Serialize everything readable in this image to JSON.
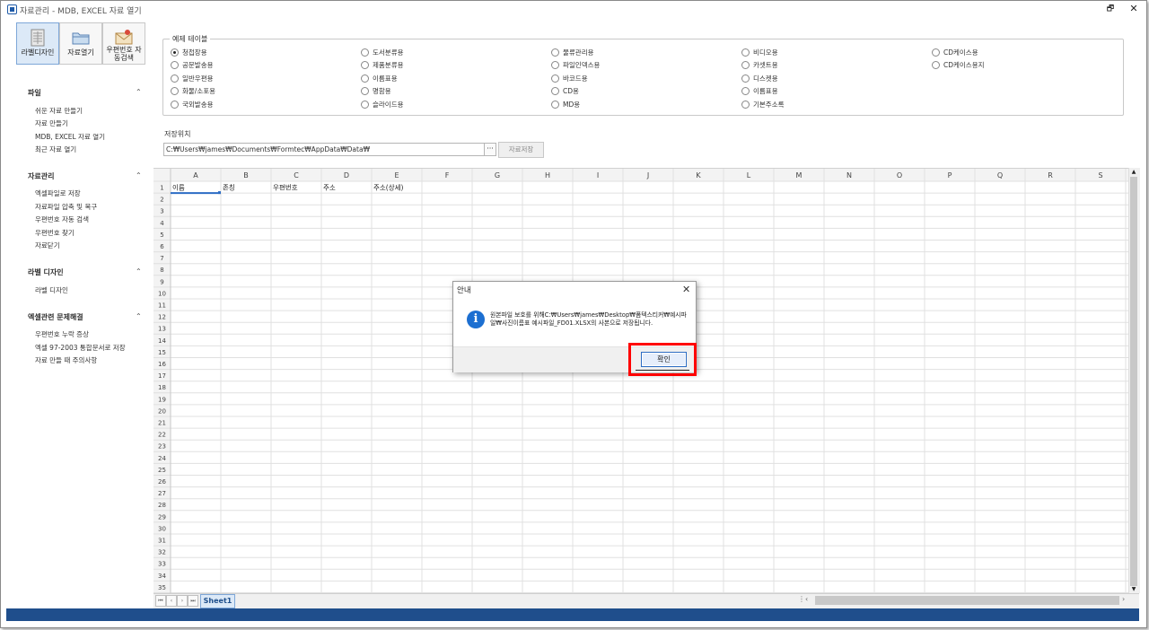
{
  "window": {
    "title": "자료관리 - MDB, EXCEL 자료 열기",
    "restore_glyph": "🗗",
    "close_glyph": "✕"
  },
  "toolbar": [
    {
      "name": "label-design-button",
      "label": "라벨디자인",
      "icon": "label-grid-icon"
    },
    {
      "name": "open-data-button",
      "label": "자료열기",
      "icon": "folder-icon"
    },
    {
      "name": "zip-search-button",
      "label": "우편번호 자동검색",
      "icon": "envelope-icon"
    }
  ],
  "sidebar": [
    {
      "title": "파일",
      "items": [
        "쉬운 자료 만들기",
        "자료 만들기",
        "MDB, EXCEL 자료 열기",
        "최근 자료 열기"
      ]
    },
    {
      "title": "자료관리",
      "items": [
        "엑셀파일로 저장",
        "자료파일 압축 및 복구",
        "우편번호 자동 검색",
        "우편번호 찾기",
        "자료닫기"
      ]
    },
    {
      "title": "라벨 디자인",
      "items": [
        "라벨 디자인"
      ]
    },
    {
      "title": "엑셀관련 문제해결",
      "items": [
        "우편번호 누락 증상",
        "엑셀 97-2003 통합문서로 저장",
        "자료 만들 때 주의사항"
      ]
    }
  ],
  "sidebar_chevron": "⌃",
  "example_tables": {
    "label": "예제 테이블",
    "columns": [
      [
        "청첩장용",
        "공문발송용",
        "일반우편용",
        "화물/소포용",
        "국외발송용"
      ],
      [
        "도서분류용",
        "제품분류용",
        "이름표용",
        "명함용",
        "슬라이드용"
      ],
      [
        "물류관리용",
        "파일인덱스용",
        "바코드용",
        "CD용",
        "MD용"
      ],
      [
        "비디오용",
        "카셋트용",
        "디스켓용",
        "이름표용",
        "기본주소록"
      ],
      [
        "CD케이스용",
        "CD케이스용지"
      ]
    ],
    "selected": "청첩장용"
  },
  "save_location": {
    "label": "저장위치",
    "path": "C:₩Users₩james₩Documents₩Formtec₩AppData₩Data₩",
    "browse": "···",
    "save_button": "자료저장"
  },
  "sheet": {
    "columns": [
      "A",
      "B",
      "C",
      "D",
      "E",
      "F",
      "G",
      "H",
      "I",
      "J",
      "K",
      "L",
      "M",
      "N",
      "O",
      "P",
      "Q",
      "R",
      "S"
    ],
    "row_count": 35,
    "header_row": [
      "이름",
      "존칭",
      "우편번호",
      "주소",
      "주소(상세)"
    ],
    "tab": "Sheet1",
    "nav": [
      "⏮",
      "‹",
      "›",
      "⏭"
    ],
    "hscroll_dots": "⋮",
    "hscroll_left": "‹",
    "hscroll_right": "›",
    "vscroll_up": "▲",
    "vscroll_down": "▼"
  },
  "dialog": {
    "title": "안내",
    "close_glyph": "✕",
    "icon_glyph": "i",
    "message": "원본파일 보호를 위해C:₩Users₩james₩Desktop₩폼텍스티커₩예시파일₩사진이름표 예시파일_FD01.XLSX의 사본으로 저장됩니다.",
    "ok_label": "확인"
  },
  "colors": {
    "accent": "#1f4e8c",
    "highlight": "#ff0000",
    "info_icon": "#1c6fd1"
  }
}
